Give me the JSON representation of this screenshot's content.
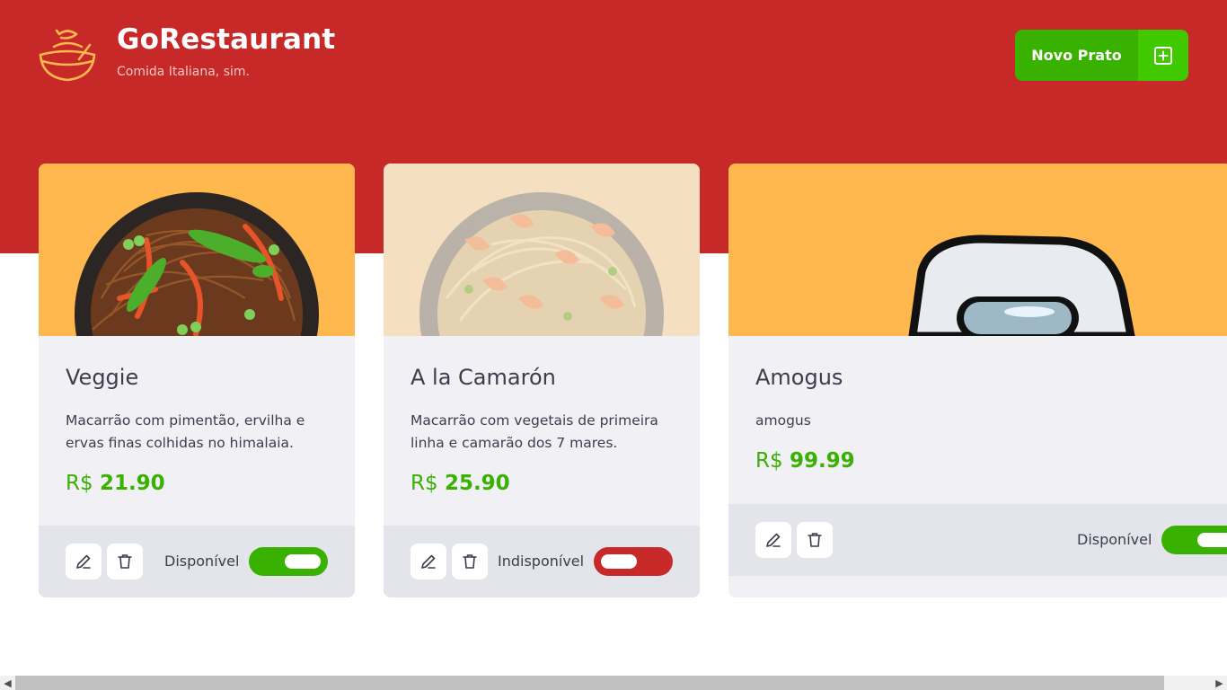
{
  "header": {
    "title": "GoRestaurant",
    "subtitle": "Comida Italiana, sim.",
    "new_button_label": "Novo Prato",
    "new_button_icon": "plus-square-icon"
  },
  "colors": {
    "brand_red": "#c72828",
    "green": "#39b100",
    "green_light": "#41c900",
    "card_bg": "#f0f0f5",
    "card_footer": "#e4e4eb",
    "image_bg": "#ffb84d"
  },
  "foods": [
    {
      "name": "Veggie",
      "description": "Macarrão com pimentão, ervilha e ervas finas colhidas no himalaia.",
      "currency": "R$",
      "price": "21.90",
      "available": true,
      "status_label": "Disponível",
      "image": "noodles-with-vegetables"
    },
    {
      "name": "A la Camarón",
      "description": "Macarrão com vegetais de primeira linha e camarão dos 7 mares.",
      "currency": "R$",
      "price": "25.90",
      "available": false,
      "status_label": "Indisponível",
      "image": "noodles-with-shrimp"
    },
    {
      "name": "Amogus",
      "description": "amogus",
      "currency": "R$",
      "price": "99.99",
      "available": true,
      "status_label": "Disponível",
      "image": "amogus-character"
    }
  ],
  "icons": {
    "edit": "pencil-icon",
    "delete": "trash-icon"
  }
}
